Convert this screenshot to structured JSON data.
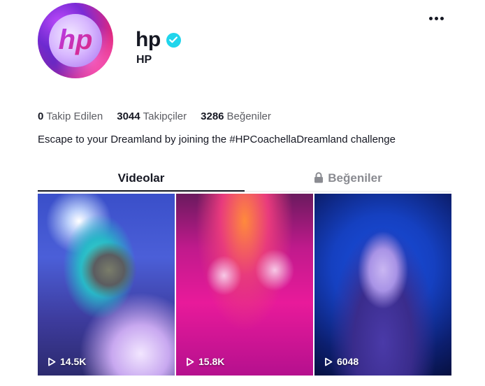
{
  "profile": {
    "username": "hp",
    "nickname": "HP",
    "verified": true,
    "avatar_text": "hp",
    "bio": "Escape to your Dreamland by joining the #HPCoachellaDreamland challenge"
  },
  "stats": {
    "following": {
      "value": "0",
      "label": "Takip Edilen"
    },
    "followers": {
      "value": "3044",
      "label": "Takipçiler"
    },
    "likes": {
      "value": "3286",
      "label": "Beğeniler"
    }
  },
  "tabs": [
    {
      "label": "Videolar",
      "active": true,
      "locked": false
    },
    {
      "label": "Beğeniler",
      "active": false,
      "locked": true
    }
  ],
  "videos": [
    {
      "views": "14.5K"
    },
    {
      "views": "15.8K"
    },
    {
      "views": "6048"
    }
  ],
  "colors": {
    "verified": "#20d5ec",
    "text": "#161823",
    "muted": "#8a8b91"
  },
  "icons": {
    "more": "more-icon",
    "verified": "verified-check-icon",
    "lock": "lock-icon",
    "play": "play-icon"
  }
}
